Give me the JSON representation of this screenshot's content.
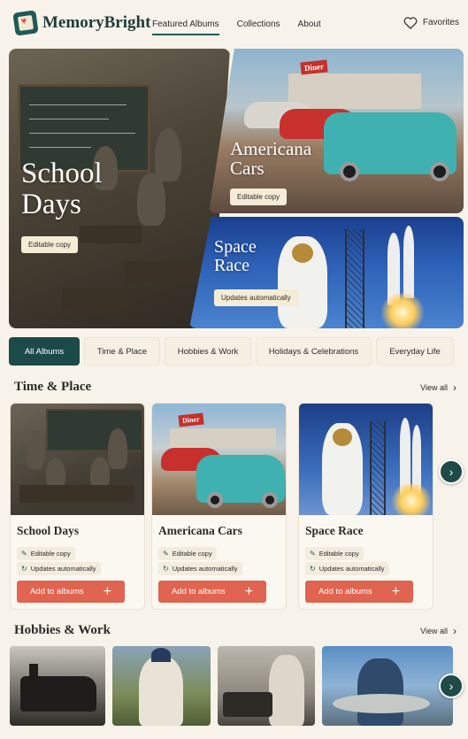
{
  "header": {
    "brand": "MemoryBright",
    "nav": [
      "Featured Albums",
      "Collections",
      "About"
    ],
    "favorites_label": "Favorites"
  },
  "hero": {
    "school": {
      "title_line1": "School",
      "title_line2": "Days",
      "badge": "Editable copy",
      "chalkboard_text": "School Days"
    },
    "cars": {
      "title_line1": "Americana",
      "title_line2": "Cars",
      "badge": "Editable copy",
      "sign_text": "Diner"
    },
    "space": {
      "title_line1": "Space",
      "title_line2": "Race",
      "badge": "Updates automatically"
    }
  },
  "filters": [
    "All Albums",
    "Time & Place",
    "Hobbies & Work",
    "Holidays & Celebrations",
    "Everyday Life"
  ],
  "sections": {
    "time_place": {
      "title": "Time & Place",
      "view_all": "View all",
      "cards": [
        {
          "title": "School Days",
          "chip1": "Editable copy",
          "chip2": "Updates automatically",
          "button": "Add to albums"
        },
        {
          "title": "Americana Cars",
          "chip1": "Editable copy",
          "chip2": "Updates automatically",
          "button": "Add to albums"
        },
        {
          "title": "Space Race",
          "chip1": "Editable copy",
          "chip2": "Updates automatically",
          "button": "Add to albums"
        }
      ]
    },
    "hobbies_work": {
      "title": "Hobbies & Work",
      "view_all": "View all"
    }
  },
  "colors": {
    "brand_teal": "#1f5a55",
    "accent_coral": "#e06450",
    "background": "#f7f3ea"
  }
}
